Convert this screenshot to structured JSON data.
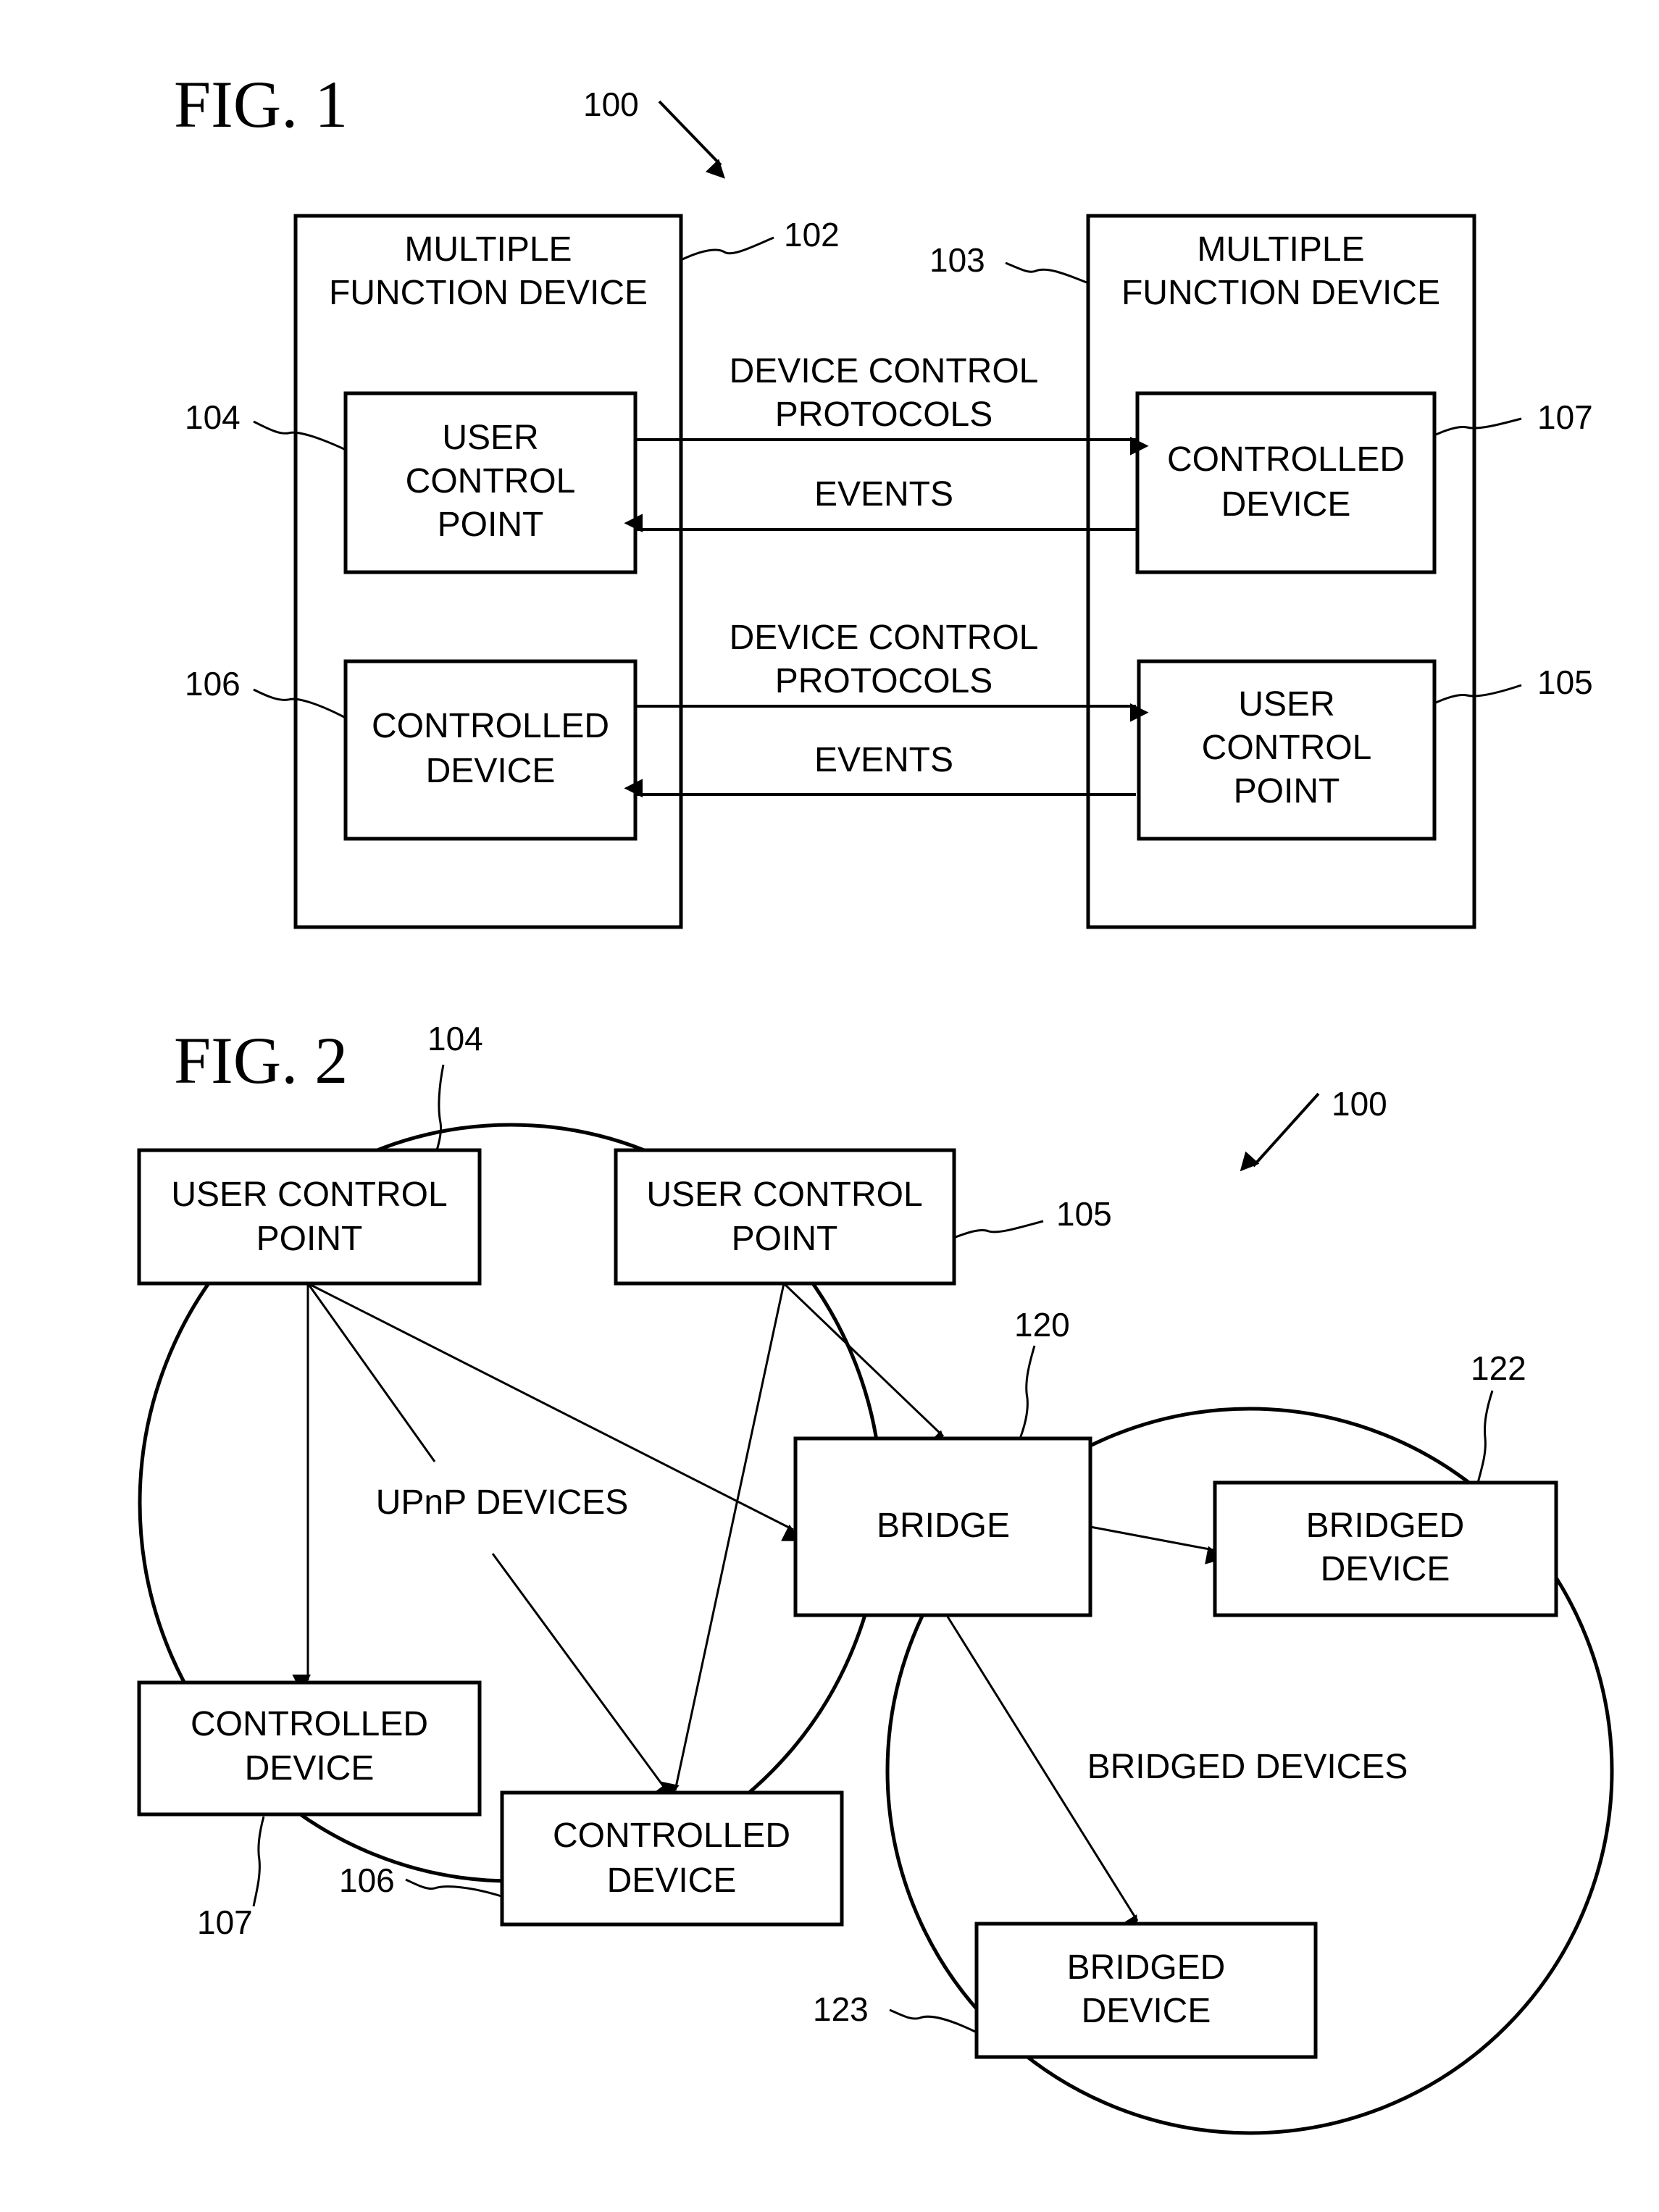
{
  "colors": {
    "ink": "#000000",
    "paper": "#ffffff"
  },
  "fig1": {
    "title": "FIG. 1",
    "system_ref": "100",
    "mfd_left": {
      "ref": "102",
      "label_lines": [
        "MULTIPLE",
        "FUNCTION DEVICE"
      ]
    },
    "mfd_right": {
      "ref": "103",
      "label_lines": [
        "MULTIPLE",
        "FUNCTION DEVICE"
      ]
    },
    "ucp_104": {
      "ref": "104",
      "label_lines": [
        "USER",
        "CONTROL",
        "POINT"
      ]
    },
    "cd_107": {
      "ref": "107",
      "label_lines": [
        "CONTROLLED",
        "DEVICE"
      ]
    },
    "cd_106": {
      "ref": "106",
      "label_lines": [
        "CONTROLLED",
        "DEVICE"
      ]
    },
    "ucp_105": {
      "ref": "105",
      "label_lines": [
        "USER",
        "CONTROL",
        "POINT"
      ]
    },
    "top_protocols": [
      "DEVICE CONTROL",
      "PROTOCOLS"
    ],
    "top_events": "EVENTS",
    "bottom_protocols": [
      "DEVICE CONTROL",
      "PROTOCOLS"
    ],
    "bottom_events": "EVENTS"
  },
  "fig2": {
    "title": "FIG. 2",
    "system_ref": "100",
    "ucp_104": {
      "ref": "104",
      "label_lines": [
        "USER CONTROL",
        "POINT"
      ]
    },
    "ucp_105": {
      "ref": "105",
      "label_lines": [
        "USER CONTROL",
        "POINT"
      ]
    },
    "bridge": {
      "ref": "120",
      "label": "BRIDGE"
    },
    "bridged_122": {
      "ref": "122",
      "label_lines": [
        "BRIDGED",
        "DEVICE"
      ]
    },
    "cd_107": {
      "ref": "107",
      "label_lines": [
        "CONTROLLED",
        "DEVICE"
      ]
    },
    "cd_106": {
      "ref": "106",
      "label_lines": [
        "CONTROLLED",
        "DEVICE"
      ]
    },
    "bridged_123": {
      "ref": "123",
      "label_lines": [
        "BRIDGED",
        "DEVICE"
      ]
    },
    "upnp_group_label": "UPnP DEVICES",
    "bridged_group_label": "BRIDGED DEVICES"
  }
}
